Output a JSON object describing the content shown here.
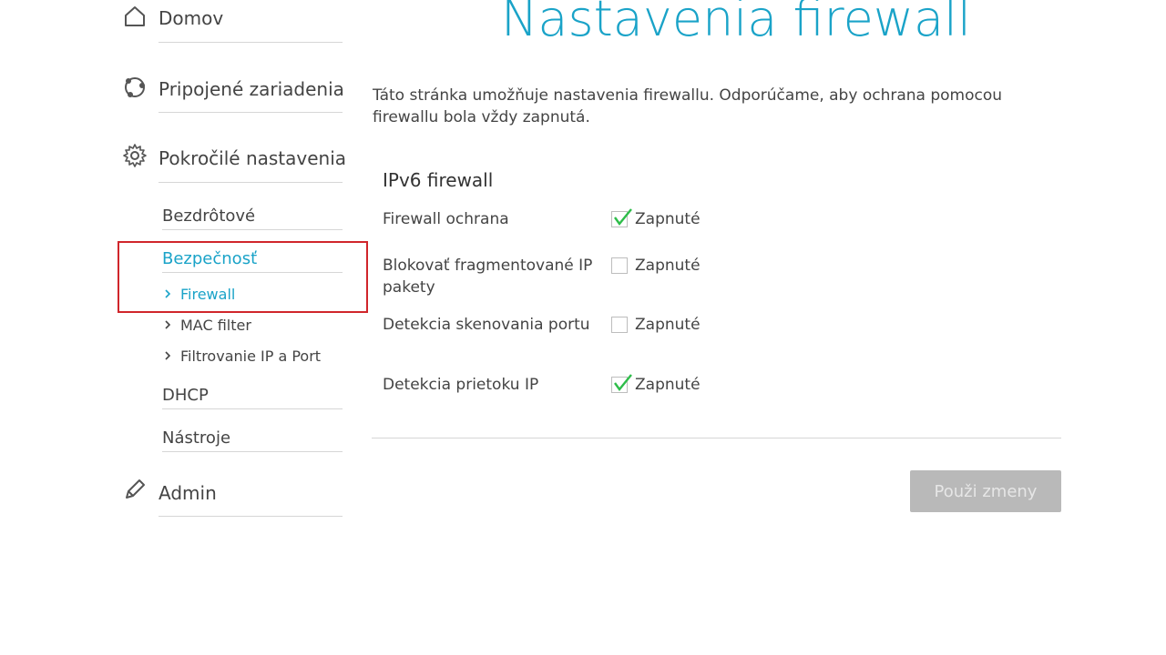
{
  "sidebar": {
    "main": [
      {
        "label": "Domov",
        "icon": "home-icon"
      },
      {
        "label": "Pripojené zariadenia",
        "icon": "devices-icon"
      },
      {
        "label": "Pokročilé nastavenia",
        "icon": "gear-icon"
      },
      {
        "label": "Admin",
        "icon": "pencil-icon"
      }
    ],
    "sub": [
      {
        "label": "Bezdrôtové"
      },
      {
        "label": "Bezpečnosť"
      },
      {
        "label": "DHCP"
      },
      {
        "label": "Nástroje"
      }
    ],
    "security_items": [
      {
        "label": "Firewall"
      },
      {
        "label": "MAC filter"
      },
      {
        "label": "Filtrovanie IP a Port"
      }
    ]
  },
  "main": {
    "title": "Nastavenia firewall",
    "description": "Táto stránka umožňuje nastavenia firewallu. Odporúčame, aby ochrana pomocou firewallu bola vždy zapnutá.",
    "section_title": "IPv6 firewall",
    "settings": [
      {
        "label": "Firewall ochrana",
        "checkbox_label": "Zapnuté",
        "checked": true
      },
      {
        "label": "Blokovať fragmentované IP pakety",
        "checkbox_label": "Zapnuté",
        "checked": false
      },
      {
        "label": "Detekcia skenovania portu",
        "checkbox_label": "Zapnuté",
        "checked": false
      },
      {
        "label": "Detekcia prietoku IP",
        "checkbox_label": "Zapnuté",
        "checked": true
      }
    ],
    "apply_label": "Použi zmeny"
  },
  "colors": {
    "accent": "#1aa3c8",
    "highlight": "#d0262b",
    "check": "#2ebd4a",
    "button_disabled": "#b9b9b9"
  }
}
